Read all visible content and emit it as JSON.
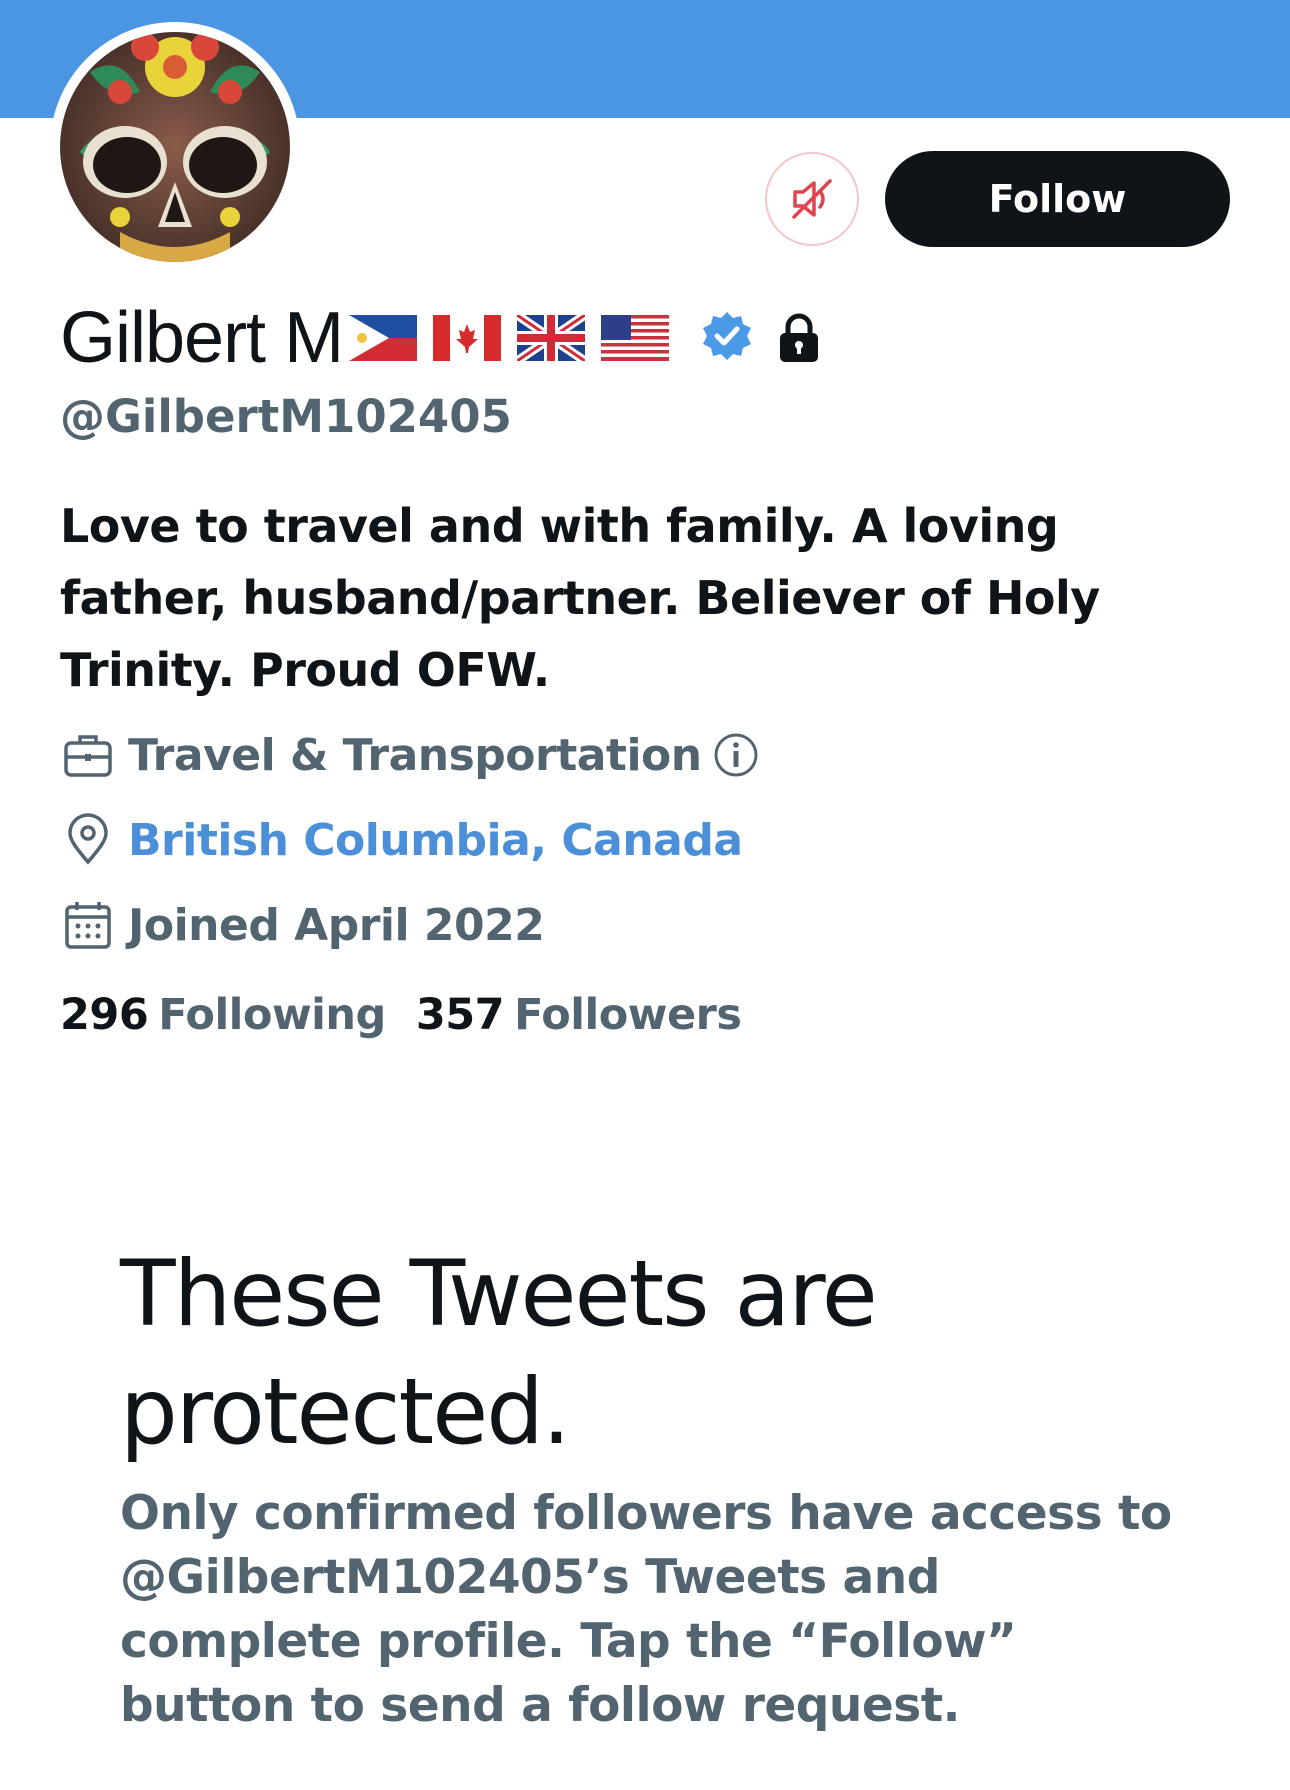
{
  "profile": {
    "display_name": "Gilbert M",
    "flags": [
      "flag-philippines-icon",
      "flag-canada-icon",
      "flag-uk-icon",
      "flag-usa-icon"
    ],
    "verified_icon": "verified-badge-icon",
    "protected_icon": "lock-icon",
    "handle": "@GilbertM102405",
    "bio": "Love to travel and with family. A loving father, husband/partner. Believer of Holy Trinity. Proud OFW.",
    "category": "Travel & Transportation",
    "location": "British Columbia, Canada",
    "joined": "Joined April 2022",
    "following_count": "296",
    "following_label": "Following",
    "followers_count": "357",
    "followers_label": "Followers"
  },
  "actions": {
    "mute_icon": "muted-speaker-icon",
    "follow_label": "Follow"
  },
  "protected_notice": {
    "title": "These Tweets are protected.",
    "description": "Only confirmed followers have access to @GilbertM102405’s Tweets and complete profile. Tap the “Follow” button to send a follow request."
  },
  "colors": {
    "banner": "#4a96e2",
    "primary_text": "#0f1419",
    "secondary_text": "#536471",
    "link": "#4a8fd8",
    "verified": "#4b9ae8",
    "mute_red": "#e0444e"
  }
}
